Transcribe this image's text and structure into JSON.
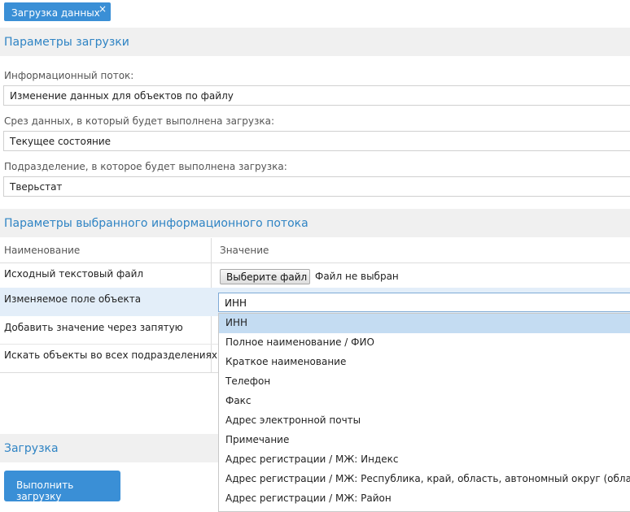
{
  "tab": {
    "label": "Загрузка данных",
    "close_glyph": "×"
  },
  "params": {
    "header": "Параметры загрузки",
    "stream_label": "Информационный поток:",
    "stream_value": "Изменение данных для объектов по файлу",
    "slice_label": "Срез данных, в который будет выполнена загрузка:",
    "slice_value": "Текущее состояние",
    "division_label": "Подразделение, в которое будет выполнена загрузка:",
    "division_value": "Тверьстат"
  },
  "stream_params": {
    "header": "Параметры выбранного информационного потока",
    "col_name": "Наименование",
    "col_value": "Значение",
    "rows": [
      {
        "label": "Исходный текстовый файл"
      },
      {
        "label": "Изменяемое поле объекта"
      },
      {
        "label": "Добавить значение через запятую"
      },
      {
        "label": "Искать объекты во всех подразделениях"
      }
    ],
    "file_button": "Выберите файл",
    "file_status": "Файл не выбран",
    "field_select": {
      "value": "ИНН",
      "options": [
        "ИНН",
        "Полное наименование / ФИО",
        "Краткое наименование",
        "Телефон",
        "Факс",
        "Адрес электронной почты",
        "Примечание",
        "Адрес регистрации / МЖ: Индекс",
        "Адрес регистрации / МЖ: Республика, край, область, автономный округ (область)",
        "Адрес регистрации / МЖ: Район"
      ]
    }
  },
  "load": {
    "header": "Загрузка",
    "run_button": "Выполнить загрузку"
  },
  "colors": {
    "accent": "#3a8fd6",
    "header_text": "#2f84c4",
    "section_bg": "#f0f0f0",
    "row_highlight": "#e3eef9",
    "option_selected": "#c4dcf2"
  }
}
